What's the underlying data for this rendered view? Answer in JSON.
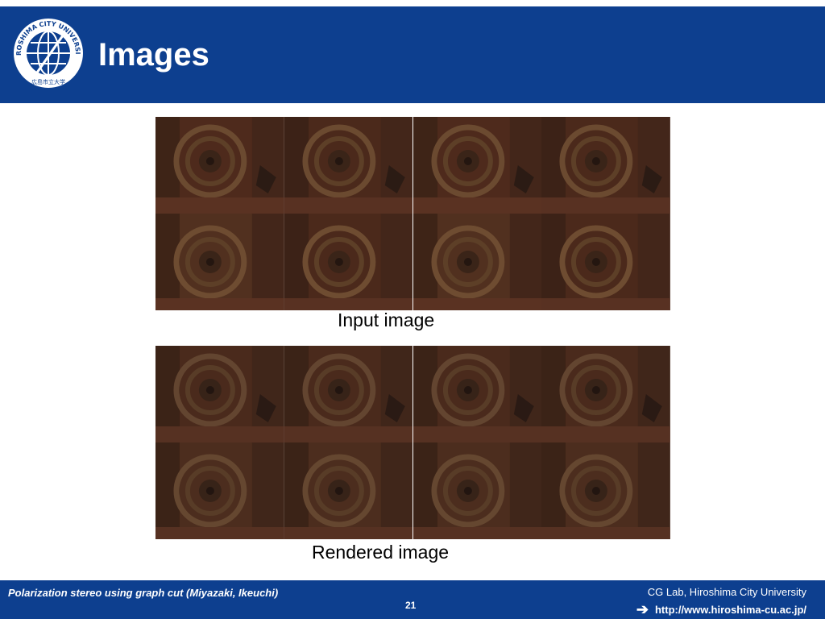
{
  "slide": {
    "title": "Images",
    "input_caption": "Input image",
    "rendered_caption": "Rendered image"
  },
  "logo": {
    "text": "HIROSHIMA CITY UNIVERSITY 広島市立大学"
  },
  "footer": {
    "left_text": "Polarization stereo using graph cut (Miyazaki, Ikeuchi)",
    "page_number": "21",
    "lab": "CG Lab, Hiroshima City University",
    "url": "http://www.hiroshima-cu.ac.jp/"
  },
  "colors": {
    "brand_blue": "#0d3f8f"
  },
  "icons": {
    "url_arrow": "arrow-right-icon"
  }
}
